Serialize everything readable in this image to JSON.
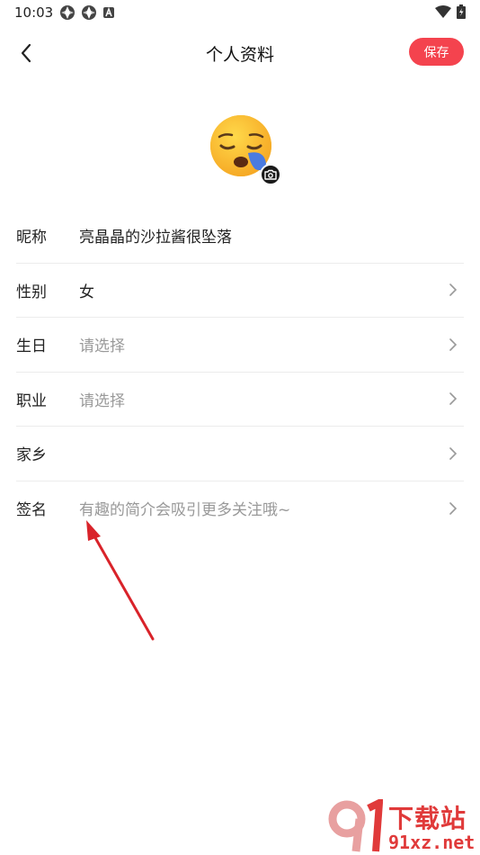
{
  "status_bar": {
    "time": "10:03"
  },
  "nav": {
    "title": "个人资料",
    "save_label": "保存"
  },
  "form": {
    "rows": [
      {
        "label": "昵称",
        "value": "亮晶晶的沙拉酱很坠落",
        "placeholder": false,
        "has_chevron": false
      },
      {
        "label": "性别",
        "value": "女",
        "placeholder": false,
        "has_chevron": true
      },
      {
        "label": "生日",
        "value": "请选择",
        "placeholder": true,
        "has_chevron": true
      },
      {
        "label": "职业",
        "value": "请选择",
        "placeholder": true,
        "has_chevron": true
      },
      {
        "label": "家乡",
        "value": "",
        "placeholder": false,
        "has_chevron": true
      },
      {
        "label": "签名",
        "value": "有趣的简介会吸引更多关注哦~",
        "placeholder": true,
        "has_chevron": true
      }
    ]
  },
  "watermark": {
    "text": "下载站",
    "url": "91xz.net"
  },
  "colors": {
    "accent": "#f4434e",
    "arrow": "#d9232a",
    "divider": "#ececec",
    "placeholder": "#999999"
  },
  "icons": {
    "back": "chevron-left-icon",
    "camera": "camera-icon",
    "chevron": "chevron-right-icon",
    "avatar": "sleepy-face-emoji"
  }
}
